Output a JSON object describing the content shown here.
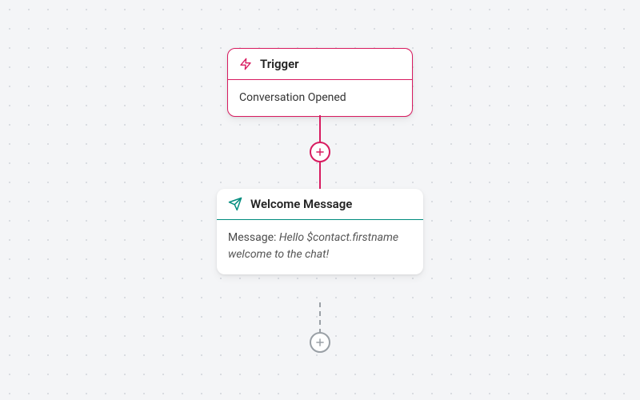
{
  "nodes": {
    "trigger": {
      "title": "Trigger",
      "body": "Conversation Opened"
    },
    "welcome": {
      "title": "Welcome Message",
      "label": "Message: ",
      "content": "Hello $contact.firstname welcome to the chat!"
    }
  },
  "colors": {
    "accent_pink": "#d81b60",
    "accent_teal": "#008c7e",
    "muted": "#9aa0a6"
  }
}
